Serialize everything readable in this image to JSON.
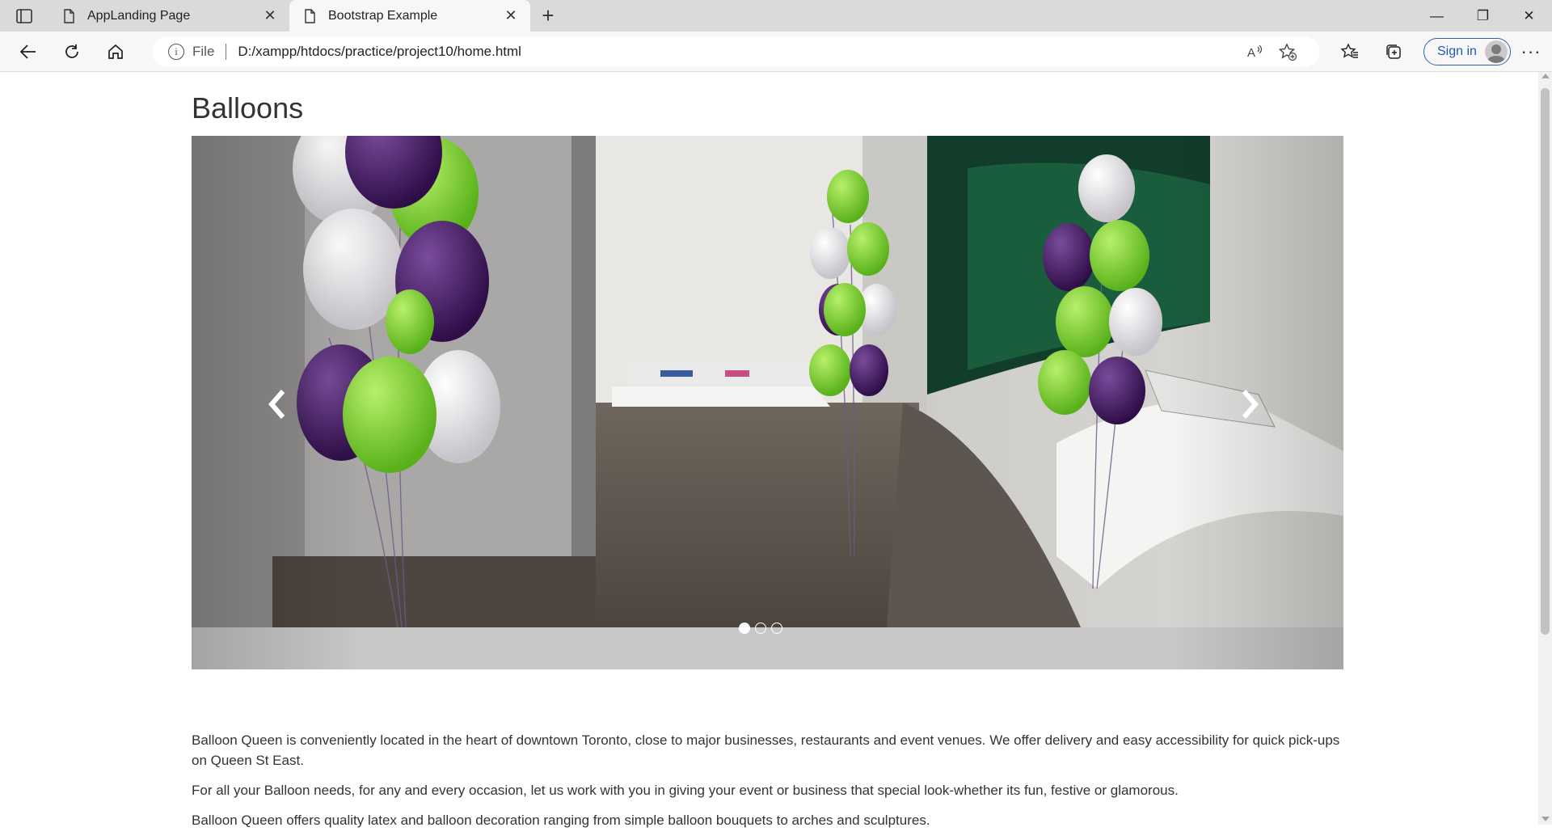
{
  "browser": {
    "tabs": [
      {
        "title": "AppLanding Page",
        "active": false
      },
      {
        "title": "Bootstrap Example",
        "active": true
      }
    ],
    "address": {
      "scheme_label": "File",
      "url": "D:/xampp/htdocs/practice/project10/home.html"
    },
    "signin_label": "Sign in"
  },
  "page": {
    "heading": "Balloons",
    "carousel": {
      "slide_count": 3,
      "active_index": 0,
      "image": "balloon-bouquets-in-store"
    },
    "paragraphs": [
      "Balloon Queen is conveniently located in the heart of downtown Toronto, close to major businesses, restaurants and event venues. We offer delivery and easy accessibility for quick pick-ups on Queen St East.",
      "For all your Balloon needs, for any and every occasion, let us work with you in giving your event or business that special look-whether its fun, festive or glamorous.",
      "Balloon Queen offers quality latex and balloon decoration ranging from simple balloon bouquets to arches and sculptures."
    ]
  },
  "colors": {
    "purple_balloon": "#4b1f6a",
    "green_balloon": "#7ed321",
    "white_balloon": "#e9e7ea",
    "accent_signin": "#1e5bb5"
  }
}
